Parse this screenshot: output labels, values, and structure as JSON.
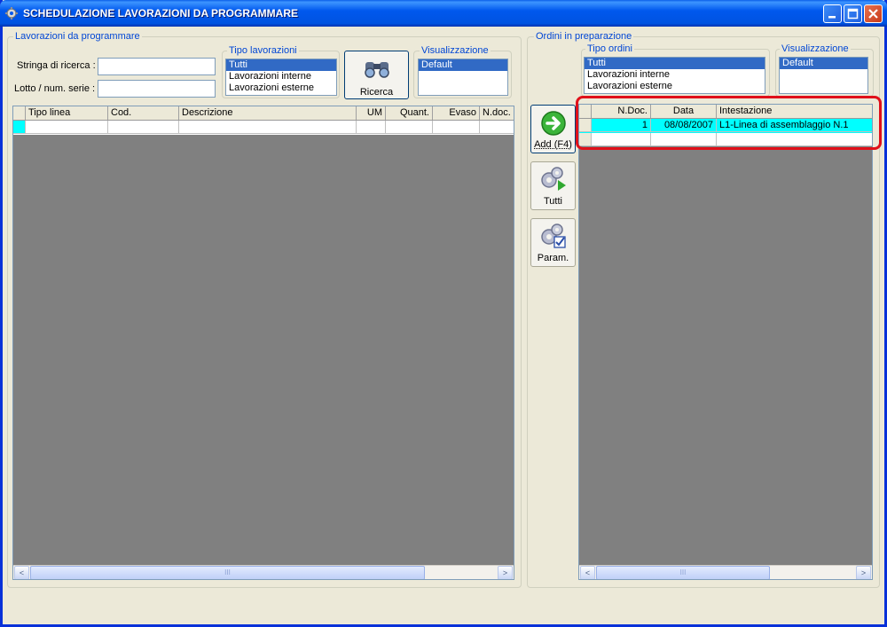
{
  "window": {
    "title": "SCHEDULAZIONE LAVORAZIONI DA PROGRAMMARE"
  },
  "left": {
    "group_label": "Lavorazioni da programmare",
    "search_label": "Stringa di ricerca :",
    "search_value": "",
    "lot_label": "Lotto / num. serie :",
    "lot_value": "",
    "tipo_group_label": "Tipo lavorazioni",
    "tipo_options": [
      "Tutti",
      "Lavorazioni interne",
      "Lavorazioni esterne"
    ],
    "tipo_selected": "Tutti",
    "ricerca_label": "Ricerca",
    "vis_group_label": "Visualizzazione",
    "vis_options": [
      "Default"
    ],
    "columns": [
      "Tipo linea",
      "Cod.",
      "Descrizione",
      "UM",
      "Quant.",
      "Evaso",
      "N.doc."
    ]
  },
  "middle": {
    "add_label": "Add (F4)",
    "tutti_label": "Tutti",
    "param_label": "Param."
  },
  "right": {
    "group_label": "Ordini in preparazione",
    "tipo_group_label": "Tipo ordini",
    "tipo_options": [
      "Tutti",
      "Lavorazioni interne",
      "Lavorazioni esterne"
    ],
    "tipo_selected": "Tutti",
    "vis_group_label": "Visualizzazione",
    "vis_options": [
      "Default"
    ],
    "columns": [
      "N.Doc.",
      "Data",
      "Intestazione"
    ],
    "rows": [
      {
        "ndoc": "1",
        "data": "08/08/2007",
        "intestazione": "L1-Linea di assemblaggio N.1"
      }
    ]
  },
  "scroll": {
    "thumb_glyph": "III",
    "left_arrow": "<",
    "right_arrow": ">"
  },
  "colors": {
    "title_bar": "#0058EE",
    "selection": "#316AC5",
    "highlight_row": "#00FFFF",
    "annotation_border": "#E0101A",
    "group_label": "#0046D5"
  }
}
